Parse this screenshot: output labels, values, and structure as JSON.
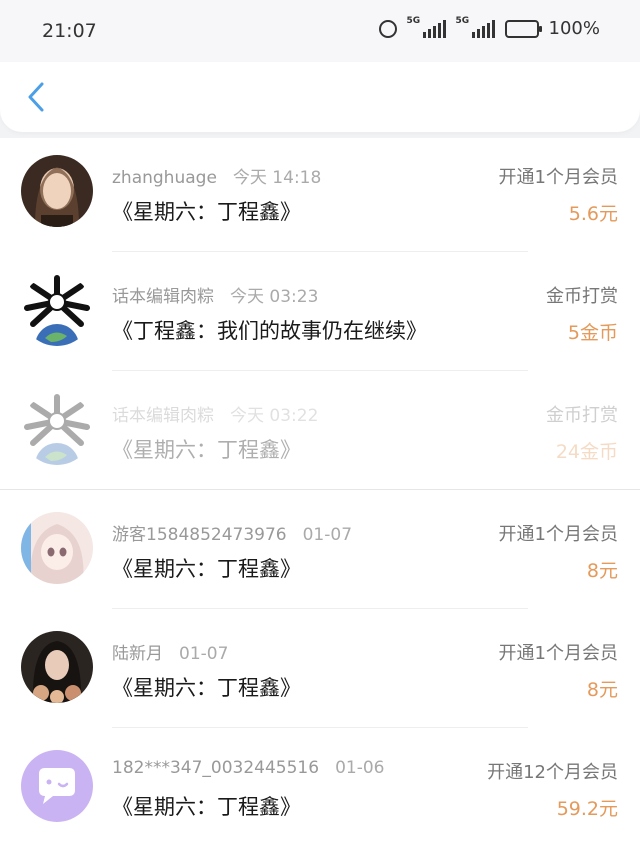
{
  "status_bar": {
    "time": "21:07",
    "signal1_label": "5G",
    "signal2_label": "5G",
    "battery": "100%"
  },
  "nav": {
    "back_icon": "chevron-left-icon",
    "accent": "#4a9fe8"
  },
  "colors": {
    "amount": "#e49a5b",
    "avatar_last_bg": "#c9b3f2"
  },
  "items": [
    {
      "user": "zhanghuage",
      "time": "今天 14:18",
      "title": "《星期六：丁程鑫》",
      "action": "开通1个月会员",
      "amount": "5.6元",
      "faded": false
    },
    {
      "user": "话本编辑肉粽",
      "time": "今天 03:23",
      "title": "《丁程鑫：我们的故事仍在继续》",
      "action": "金币打赏",
      "amount": "5金币",
      "faded": false
    },
    {
      "user": "话本编辑肉粽",
      "time": "今天 03:22",
      "title": "《星期六：丁程鑫》",
      "action": "金币打赏",
      "amount": "24金币",
      "faded": true
    },
    {
      "user": "游客1584852473976",
      "time": "01-07",
      "title": "《星期六：丁程鑫》",
      "action": "开通1个月会员",
      "amount": "8元",
      "faded": false
    },
    {
      "user": "陆新月",
      "time": "01-07",
      "title": "《星期六：丁程鑫》",
      "action": "开通1个月会员",
      "amount": "8元",
      "faded": false
    },
    {
      "user": "182***347_0032445516",
      "time": "01-06",
      "title": "《星期六：丁程鑫》",
      "action": "开通12个月会员",
      "amount": "59.2元",
      "faded": false
    }
  ]
}
